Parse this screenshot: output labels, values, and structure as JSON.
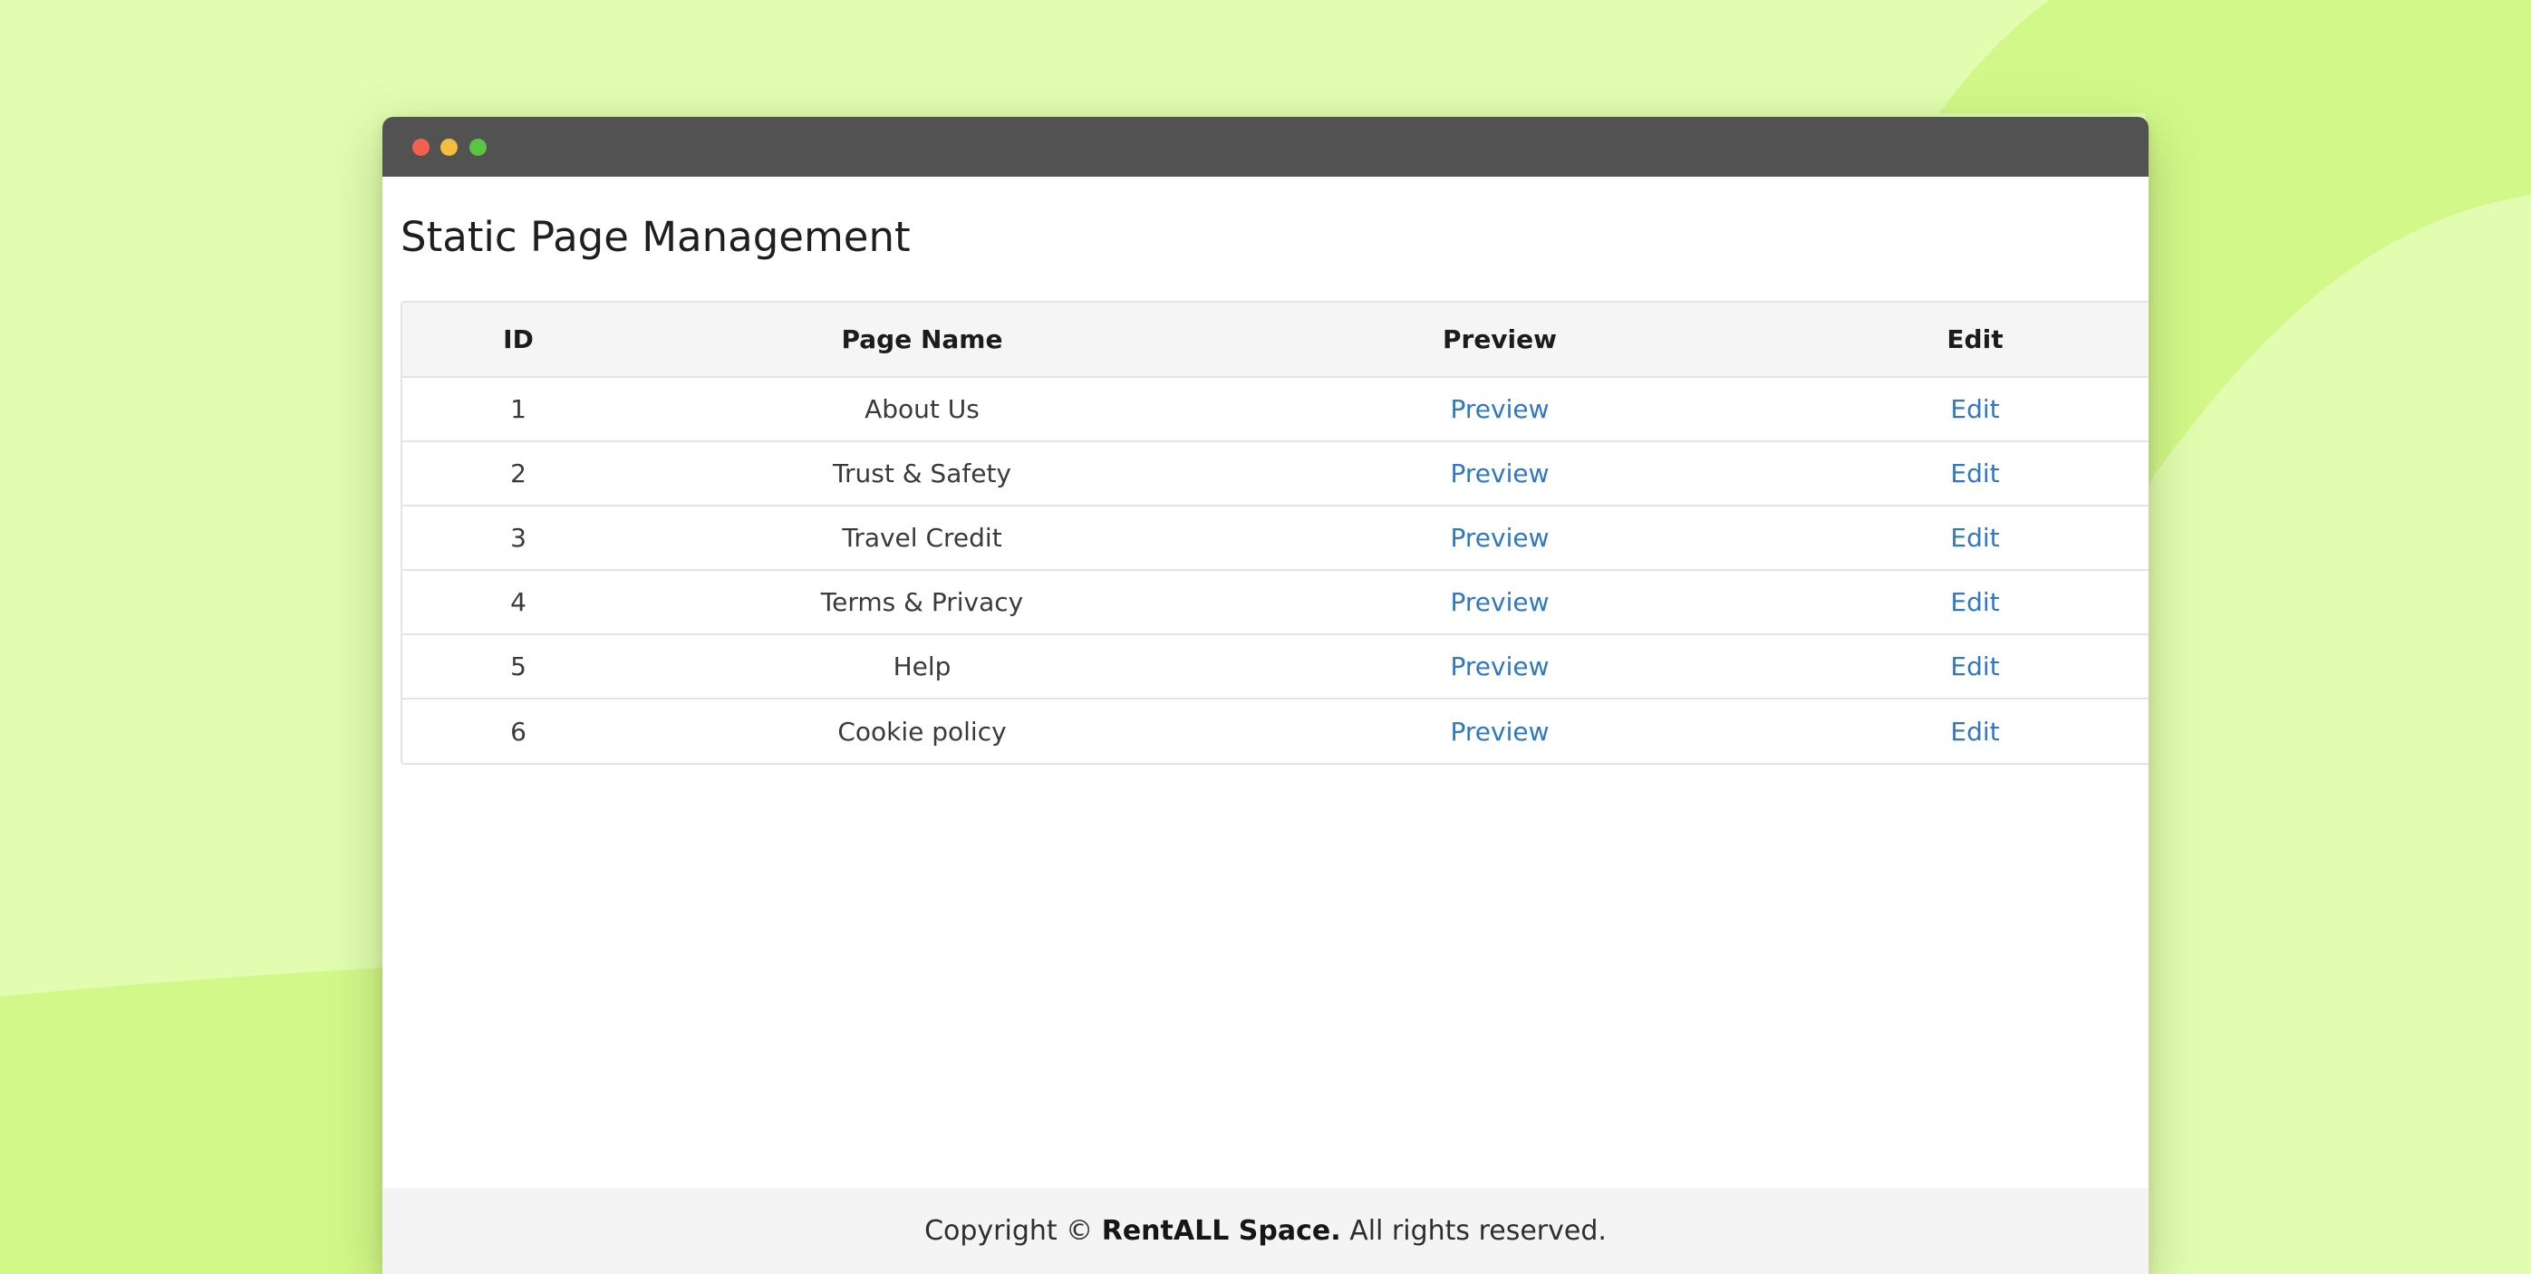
{
  "window": {
    "controls": [
      "close",
      "minimize",
      "maximize"
    ]
  },
  "page": {
    "title": "Static Page Management"
  },
  "table": {
    "headers": {
      "id": "ID",
      "page_name": "Page Name",
      "preview": "Preview",
      "edit": "Edit"
    },
    "rows": [
      {
        "id": "1",
        "page_name": "About Us",
        "preview": "Preview",
        "edit": "Edit"
      },
      {
        "id": "2",
        "page_name": "Trust & Safety",
        "preview": "Preview",
        "edit": "Edit"
      },
      {
        "id": "3",
        "page_name": "Travel Credit",
        "preview": "Preview",
        "edit": "Edit"
      },
      {
        "id": "4",
        "page_name": "Terms & Privacy",
        "preview": "Preview",
        "edit": "Edit"
      },
      {
        "id": "5",
        "page_name": "Help",
        "preview": "Preview",
        "edit": "Edit"
      },
      {
        "id": "6",
        "page_name": "Cookie policy",
        "preview": "Preview",
        "edit": "Edit"
      }
    ]
  },
  "footer": {
    "prefix": "Copyright ©",
    "brand": "RentALL Space.",
    "suffix": "All rights reserved."
  },
  "colors": {
    "background": "#e2fdb0",
    "background_accent": "#d2f889",
    "titlebar": "#525252",
    "link": "#2f78c4",
    "dot_close": "#f26052",
    "dot_minimize": "#f4bd3f",
    "dot_maximize": "#5cc443"
  }
}
